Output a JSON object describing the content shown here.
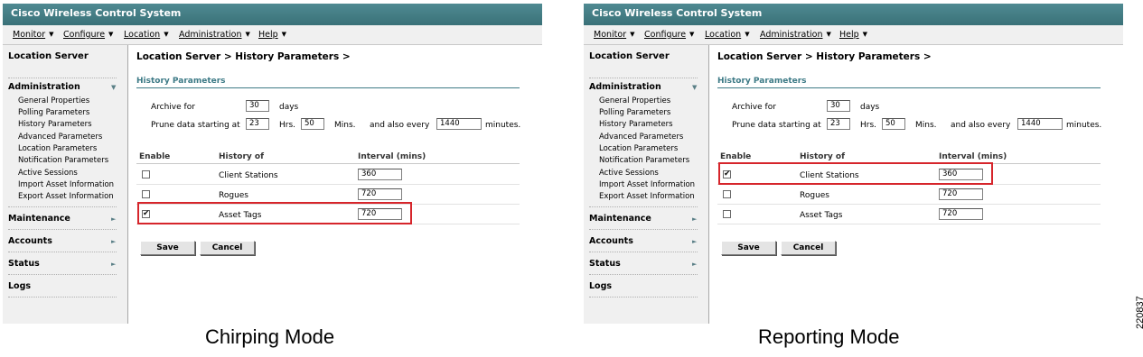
{
  "window_title": "Cisco Wireless Control System",
  "menu": [
    "Monitor",
    "Configure",
    "Location",
    "Administration",
    "Help"
  ],
  "sidebar": {
    "title": "Location Server",
    "sections": [
      {
        "label": "Administration",
        "items": [
          "General Properties",
          "Polling Parameters",
          "History Parameters",
          "Advanced Parameters",
          "Location Parameters",
          "Notification Parameters",
          "Active Sessions",
          "Import Asset Information",
          "Export Asset Information"
        ]
      },
      {
        "label": "Maintenance"
      },
      {
        "label": "Accounts"
      },
      {
        "label": "Status"
      },
      {
        "label": "Logs"
      }
    ]
  },
  "breadcrumb": "Location Server > History Parameters >",
  "section_title": "History Parameters",
  "archive": {
    "label": "Archive for",
    "value": "30",
    "unit": "days"
  },
  "prune": {
    "label": "Prune data starting at",
    "hrs_value": "23",
    "hrs_label": "Hrs.",
    "mins_value": "50",
    "mins_label": "Mins.",
    "every_label": "and also every",
    "every_value": "1440",
    "every_unit": "minutes."
  },
  "table": {
    "headers": [
      "Enable",
      "History of",
      "Interval (mins)"
    ],
    "rows": [
      {
        "label": "Client Stations",
        "interval": "360"
      },
      {
        "label": "Rogues",
        "interval": "720"
      },
      {
        "label": "Asset Tags",
        "interval": "720"
      }
    ]
  },
  "buttons": {
    "save": "Save",
    "cancel": "Cancel"
  },
  "panels": [
    {
      "caption": "Chirping Mode",
      "checked": [
        false,
        false,
        true
      ],
      "highlight_row": 2
    },
    {
      "caption": "Reporting Mode",
      "checked": [
        true,
        false,
        false
      ],
      "highlight_row": 0
    }
  ],
  "figure_number": "220837",
  "accent_color": "#3d7a86",
  "highlight_color": "#d6252b"
}
